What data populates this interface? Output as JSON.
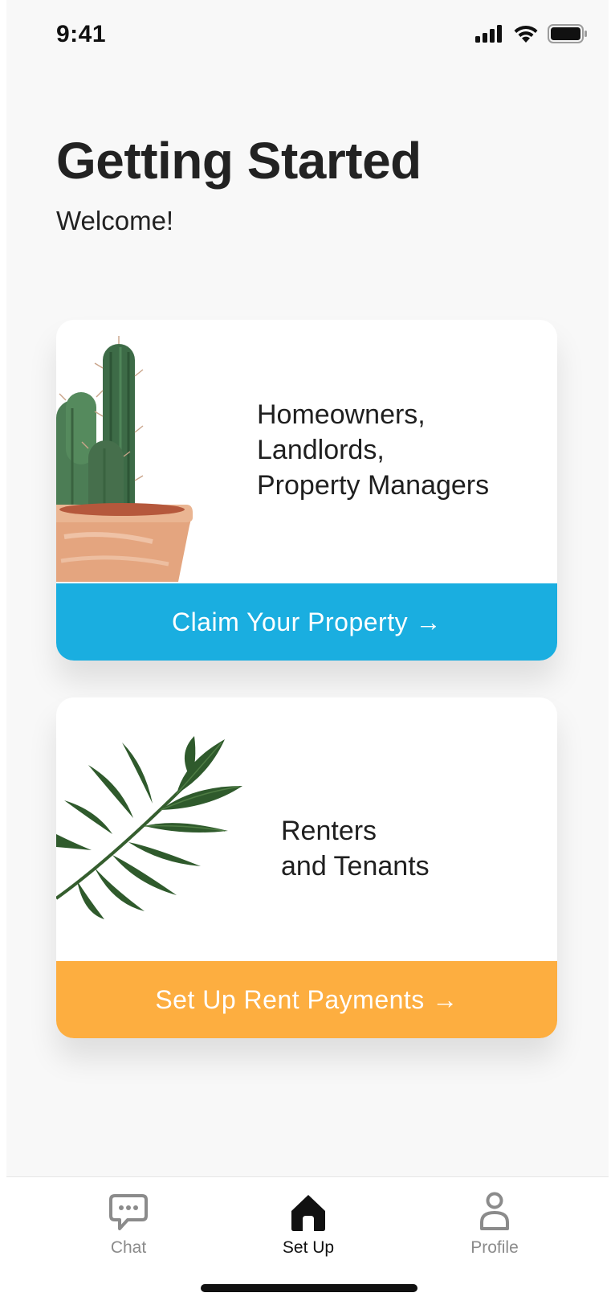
{
  "status_bar": {
    "time": "9:41",
    "icons": [
      "cellular-signal-icon",
      "wifi-icon",
      "battery-icon"
    ]
  },
  "header": {
    "title": "Getting Started",
    "subtitle": "Welcome!"
  },
  "cards": [
    {
      "illustration": "cactus-pot-icon",
      "heading_lines": [
        "Homeowners,",
        "Landlords,",
        "Property Managers"
      ],
      "button_label": "Claim Your Property →",
      "button_color": "#1AAEE0"
    },
    {
      "illustration": "palm-leaf-icon",
      "heading_lines": [
        "Renters",
        "and Tenants"
      ],
      "button_label": "Set Up Rent Payments →",
      "button_color": "#FDAE40"
    }
  ],
  "tab_bar": {
    "active": "Set Up",
    "tabs": [
      {
        "label": "Chat",
        "icon": "chat-bubble-icon"
      },
      {
        "label": "Set Up",
        "icon": "home-icon"
      },
      {
        "label": "Profile",
        "icon": "person-icon"
      }
    ]
  },
  "colors": {
    "background": "#F8F8F8",
    "text": "#1F1F1F",
    "tab_inactive": "#8B8B8B"
  }
}
